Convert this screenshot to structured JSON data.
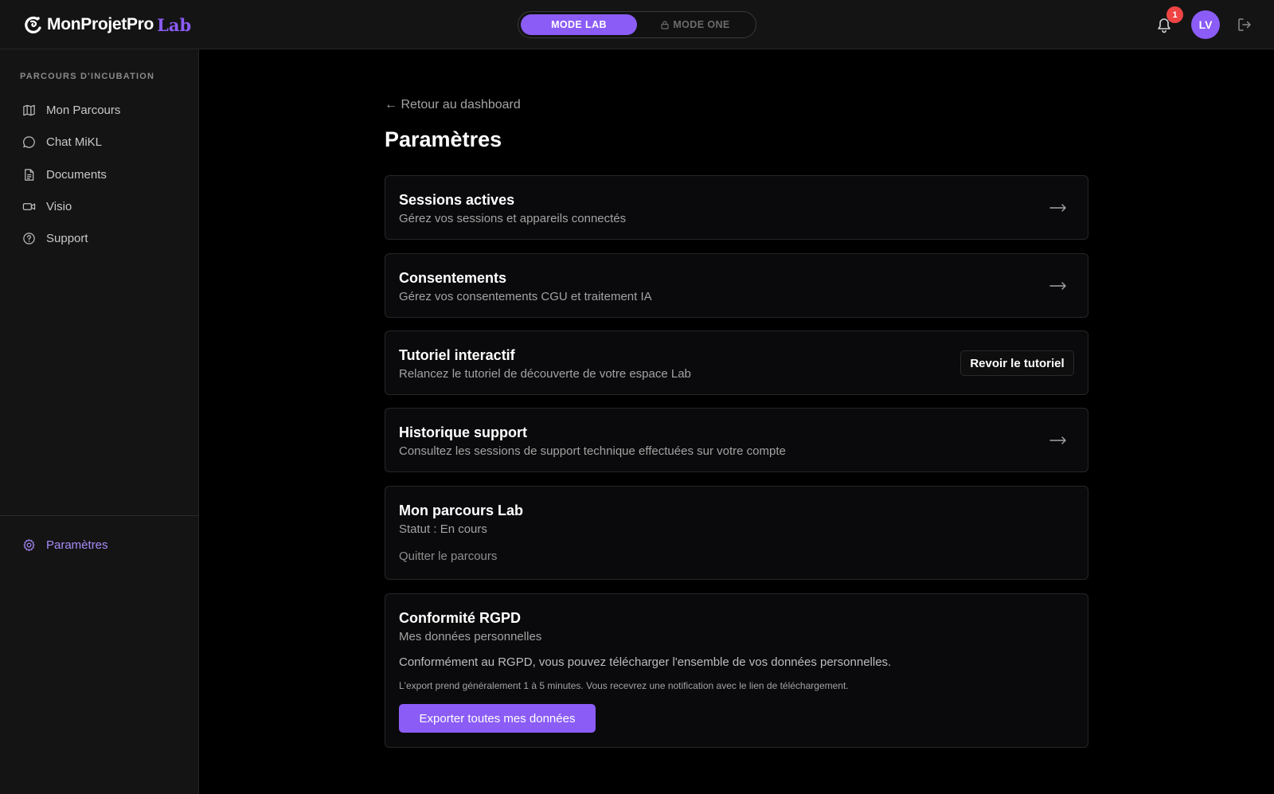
{
  "header": {
    "logo_text": "MonProjetPro",
    "logo_suffix": "Lab",
    "mode_lab_label": "MODE LAB",
    "mode_one_label": "MODE ONE",
    "notification_count": "1",
    "avatar_initials": "LV"
  },
  "sidebar": {
    "heading": "PARCOURS D'INCUBATION",
    "items": [
      {
        "label": "Mon Parcours",
        "icon": "map-icon"
      },
      {
        "label": "Chat MiKL",
        "icon": "chat-icon"
      },
      {
        "label": "Documents",
        "icon": "document-icon"
      },
      {
        "label": "Visio",
        "icon": "video-icon"
      },
      {
        "label": "Support",
        "icon": "help-icon"
      }
    ],
    "settings_label": "Paramètres"
  },
  "main": {
    "back_link": "← Retour au dashboard",
    "title": "Paramètres",
    "cards": {
      "sessions": {
        "title": "Sessions actives",
        "subtitle": "Gérez vos sessions et appareils connectés"
      },
      "consents": {
        "title": "Consentements",
        "subtitle": "Gérez vos consentements CGU et traitement IA"
      },
      "tutorial": {
        "title": "Tutoriel interactif",
        "subtitle": "Relancez le tutoriel de découverte de votre espace Lab",
        "button": "Revoir le tutoriel"
      },
      "support_history": {
        "title": "Historique support",
        "subtitle": "Consultez les sessions de support technique effectuées sur votre compte"
      },
      "lab_journey": {
        "title": "Mon parcours Lab",
        "status": "Statut : En cours",
        "quit": "Quitter le parcours"
      },
      "rgpd": {
        "title": "Conformité RGPD",
        "subtitle": "Mes données personnelles",
        "text": "Conformément au RGPD, vous pouvez télécharger l'ensemble de vos données personnelles.",
        "note": "L'export prend généralement 1 à 5 minutes. Vous recevrez une notification avec le lien de téléchargement.",
        "button": "Exporter toutes mes données"
      }
    }
  },
  "colors": {
    "accent": "#8b5cf6",
    "badge": "#ef4444",
    "background": "#000000",
    "panel": "#141414"
  }
}
